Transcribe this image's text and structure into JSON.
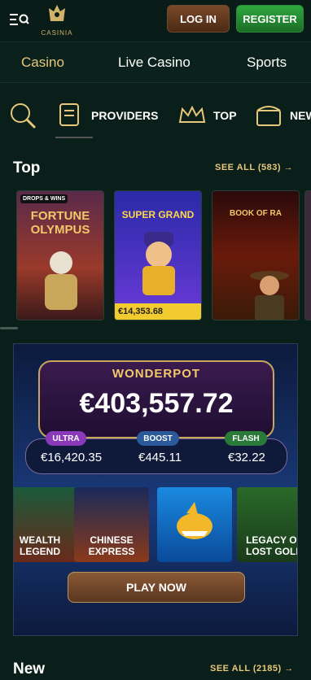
{
  "header": {
    "logo_text": "CASINIA",
    "login_label": "LOG IN",
    "register_label": "REGISTER"
  },
  "category_tabs": [
    {
      "label": "Casino",
      "active": true
    },
    {
      "label": "Live Casino"
    },
    {
      "label": "Sports"
    }
  ],
  "filters": [
    {
      "label": "",
      "icon": "search-icon"
    },
    {
      "label": "PROVIDERS",
      "icon": "scroll-icon"
    },
    {
      "label": "TOP",
      "icon": "crown-icon"
    },
    {
      "label": "NEW",
      "icon": "chest-icon"
    }
  ],
  "top_section": {
    "title": "Top",
    "see_all": "SEE ALL (583) →",
    "games": [
      {
        "title": "FORTUNE OLYMPUS",
        "badge": "DROPS & WINS"
      },
      {
        "title": "SUPER GRAND",
        "price": "€14,353.68"
      },
      {
        "title": "BOOK OF RA"
      }
    ]
  },
  "wonderpot": {
    "title": "WONDERPOT",
    "amount": "€403,557.72",
    "jackpots": [
      {
        "tag": "ULTRA",
        "value": "€16,420.35"
      },
      {
        "tag": "BOOST",
        "value": "€445.11"
      },
      {
        "tag": "FLASH",
        "value": "€32.22"
      }
    ],
    "games": [
      {
        "title": "WEALTH LEGEND"
      },
      {
        "title": "CHINESE EXPRESS"
      },
      {
        "title": "SHARK"
      },
      {
        "title": "LEGACY OF LOST GOLD"
      }
    ],
    "play_label": "PLAY NOW"
  },
  "new_section": {
    "title": "New",
    "see_all": "SEE ALL (2185) →"
  },
  "colors": {
    "accent_gold": "#e7c77a",
    "register_green": "#2fa83e",
    "background": "#0b1f1a"
  }
}
